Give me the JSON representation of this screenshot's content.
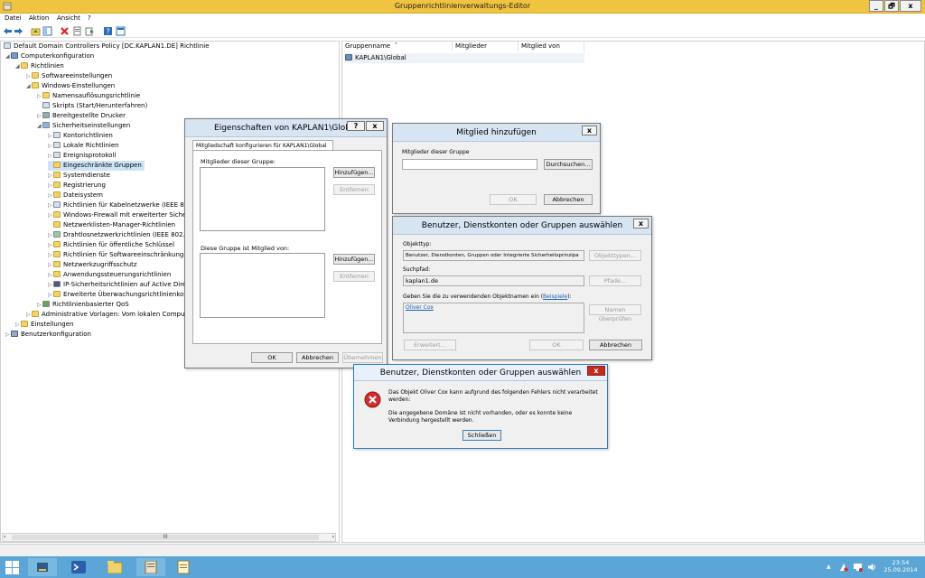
{
  "window": {
    "title": "Gruppenrichtlinienverwaltungs-Editor",
    "controls": [
      "_",
      "🗗",
      "x"
    ]
  },
  "menu": [
    "Datei",
    "Aktion",
    "Ansicht",
    "?"
  ],
  "tree": [
    {
      "label": "Default Domain Controllers Policy [DC.KAPLAN1.DE] Richtlinie",
      "icon": "policy-icon"
    },
    {
      "label": "Computerkonfiguration",
      "icon": "computer-icon"
    },
    {
      "label": "Richtlinien",
      "icon": "folder-icon"
    },
    {
      "label": "Softwareeinstellungen",
      "icon": "folder-icon"
    },
    {
      "label": "Windows-Einstellungen",
      "icon": "folder-icon"
    },
    {
      "label": "Namensauflösungsrichtlinie",
      "icon": "folder-icon"
    },
    {
      "label": "Skripts (Start/Herunterfahren)",
      "icon": "script-icon"
    },
    {
      "label": "Bereitgestellte Drucker",
      "icon": "printer-icon"
    },
    {
      "label": "Sicherheitseinstellungen",
      "icon": "security-icon"
    },
    {
      "label": "Kontorichtlinien",
      "icon": "policy-icon"
    },
    {
      "label": "Lokale Richtlinien",
      "icon": "policy-icon"
    },
    {
      "label": "Ereignisprotokoll",
      "icon": "policy-icon"
    },
    {
      "label": "Eingeschränkte Gruppen",
      "icon": "folder-icon"
    },
    {
      "label": "Systemdienste",
      "icon": "folder-icon"
    },
    {
      "label": "Registrierung",
      "icon": "folder-icon"
    },
    {
      "label": "Dateisystem",
      "icon": "folder-icon"
    },
    {
      "label": "Richtlinien für Kabelnetzwerke (IEEE 802.3",
      "icon": "network-icon"
    },
    {
      "label": "Windows-Firewall mit erweiterter Sicherh",
      "icon": "folder-icon"
    },
    {
      "label": "Netzwerklisten-Manager-Richtlinien",
      "icon": "folder-icon"
    },
    {
      "label": "Drahtlosnetzwerkrichtlinien (IEEE 802.11)",
      "icon": "network-icon"
    },
    {
      "label": "Richtlinien für öffentliche Schlüssel",
      "icon": "folder-icon"
    },
    {
      "label": "Richtlinien für Softwareeinschränkung",
      "icon": "folder-icon"
    },
    {
      "label": "Netzwerkzugriffsschutz",
      "icon": "folder-icon"
    },
    {
      "label": "Anwendungssteuerungsrichtlinien",
      "icon": "folder-icon"
    },
    {
      "label": "IP-Sicherheitsrichtlinien auf Active Direct",
      "icon": "ipsec-icon"
    },
    {
      "label": "Erweiterte Überwachungsrichtlinienkonfi",
      "icon": "folder-icon"
    },
    {
      "label": "Richtlinienbasierter QoS",
      "icon": "chart-icon"
    },
    {
      "label": "Administrative Vorlagen: Vom lokalen Compute",
      "icon": "folder-icon"
    },
    {
      "label": "Einstellungen",
      "icon": "folder-icon"
    },
    {
      "label": "Benutzerkonfiguration",
      "icon": "user-icon"
    }
  ],
  "list": {
    "columns": [
      "Gruppenname",
      "Mitglieder",
      "Mitglied von"
    ],
    "rows": [
      {
        "name": "KAPLAN1\\Global"
      }
    ]
  },
  "props_dialog": {
    "title": "Eigenschaften von KAPLAN1\\Global",
    "help": "?",
    "close": "x",
    "tab": "Mitgliedschaft konfigurieren für KAPLAN1\\Global",
    "members_label": "Mitglieder dieser Gruppe:",
    "memberof_label": "Diese Gruppe ist Mitglied von:",
    "add1": "Hinzufügen...",
    "remove1": "Entfernen",
    "add2": "Hinzufügen...",
    "remove2": "Entfernen",
    "ok": "OK",
    "cancel": "Abbrechen",
    "apply": "Übernehmen"
  },
  "add_member_dialog": {
    "title": "Mitglied hinzufügen",
    "close": "x",
    "field_label": "Mitglieder dieser Gruppe",
    "field_value": "",
    "browse": "Durchsuchen...",
    "ok": "OK",
    "cancel": "Abbrechen"
  },
  "select_dialog": {
    "title": "Benutzer, Dienstkonten oder Gruppen auswählen",
    "close": "x",
    "objtype_label": "Objekttyp:",
    "objtype_value": "Benutzer, Dienstkonten, Gruppen oder Integrierte Sicherheitsprinzipa",
    "objtype_button": "Objekttypen...",
    "path_label": "Suchpfad:",
    "path_value": "kaplan1.de",
    "path_button": "Pfade...",
    "names_label_pre": "Geben Sie die zu verwendenden Objektnamen ein (",
    "names_link": "Beispiele",
    "names_label_post": "):",
    "names_value": "Oliver Cox",
    "check_names": "Namen überprüfen",
    "advanced": "Erweitert...",
    "ok": "OK",
    "cancel": "Abbrechen"
  },
  "error_dialog": {
    "title": "Benutzer, Dienstkonten oder Gruppen auswählen",
    "close": "x",
    "line1": "Das Objekt Oliver Cox kann aufgrund des folgenden Fehlers nicht verarbeitet werden:",
    "line2": "Die angegebene Domäne ist nicht vorhanden, oder es konnte keine Verbindung hergestellt werden.",
    "close_button": "Schließen"
  },
  "tree_scroll": "III",
  "clock": {
    "time": "23:54",
    "date": "25.09.2014"
  },
  "colors": {
    "titlebar": "#f0c341",
    "taskbar": "#5ba6d6",
    "error_close": "#c42b1c",
    "error_icon": "#d12d2d"
  }
}
